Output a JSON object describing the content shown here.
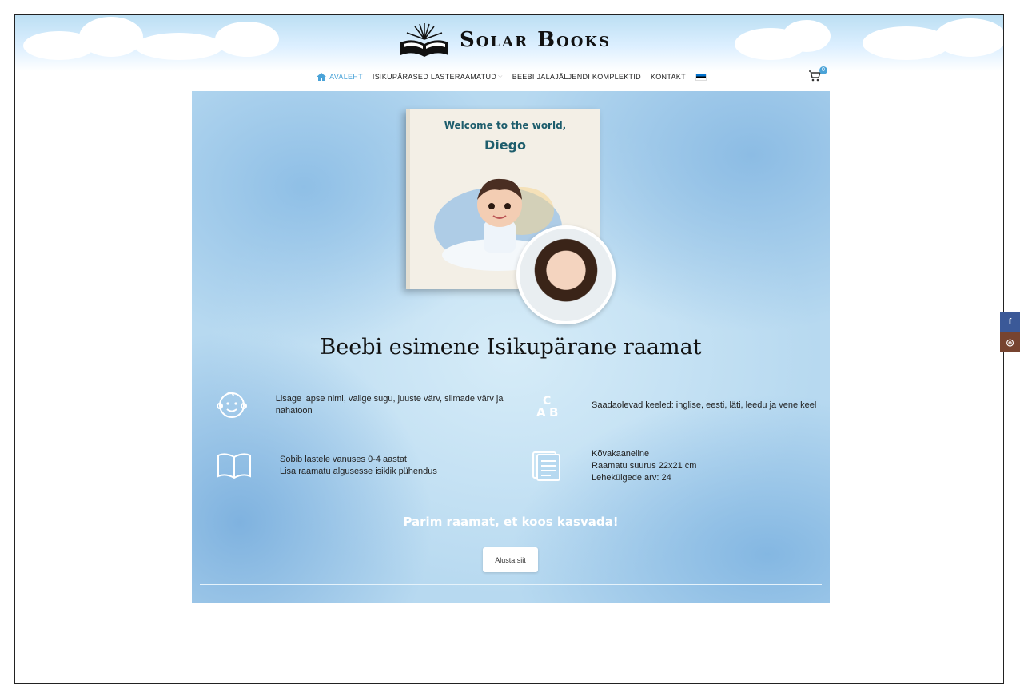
{
  "brand": {
    "name": "Solar Books",
    "logo_icon": "open-book-sunburst-icon"
  },
  "nav": {
    "items": [
      {
        "label": "AVALEHT",
        "icon": "home-icon",
        "active": true
      },
      {
        "label": "ISIKUPÄRASED LASTERAAMATUD",
        "has_dropdown": true
      },
      {
        "label": "BEEBI JALAJÄLJENDI KOMPLEKTID"
      },
      {
        "label": "KONTAKT"
      }
    ],
    "language_flag": "estonia-flag-icon"
  },
  "cart": {
    "count": "0",
    "icon": "cart-icon"
  },
  "hero": {
    "book": {
      "line1": "Welcome to the world,",
      "line2": "Diego"
    },
    "title": "Beebi esimene Isikupärane raamat",
    "features": [
      {
        "icon": "baby-face-icon",
        "text": "Lisage lapse nimi, valige sugu, juuste värv, silmade värv ja nahatoon"
      },
      {
        "icon": "abc-icon",
        "text": "Saadaolevad keeled: inglise, eesti, läti, leedu ja vene keel"
      },
      {
        "icon": "open-book-icon",
        "lines": [
          "Sobib lastele vanuses 0-4 aastat",
          "Lisa raamatu algusesse isiklik pühendus"
        ]
      },
      {
        "icon": "document-icon",
        "lines": [
          "Kõvakaaneline",
          "Raamatu suurus 22x21 cm",
          "Lehekülgede arv: 24"
        ]
      }
    ],
    "tagline": "Parim raamat, et koos kasvada!",
    "cta": "Alusta siit"
  },
  "social": [
    {
      "name": "facebook",
      "glyph": "f",
      "color": "#3b5998"
    },
    {
      "name": "instagram",
      "glyph": "◎",
      "color": "#774430"
    }
  ]
}
